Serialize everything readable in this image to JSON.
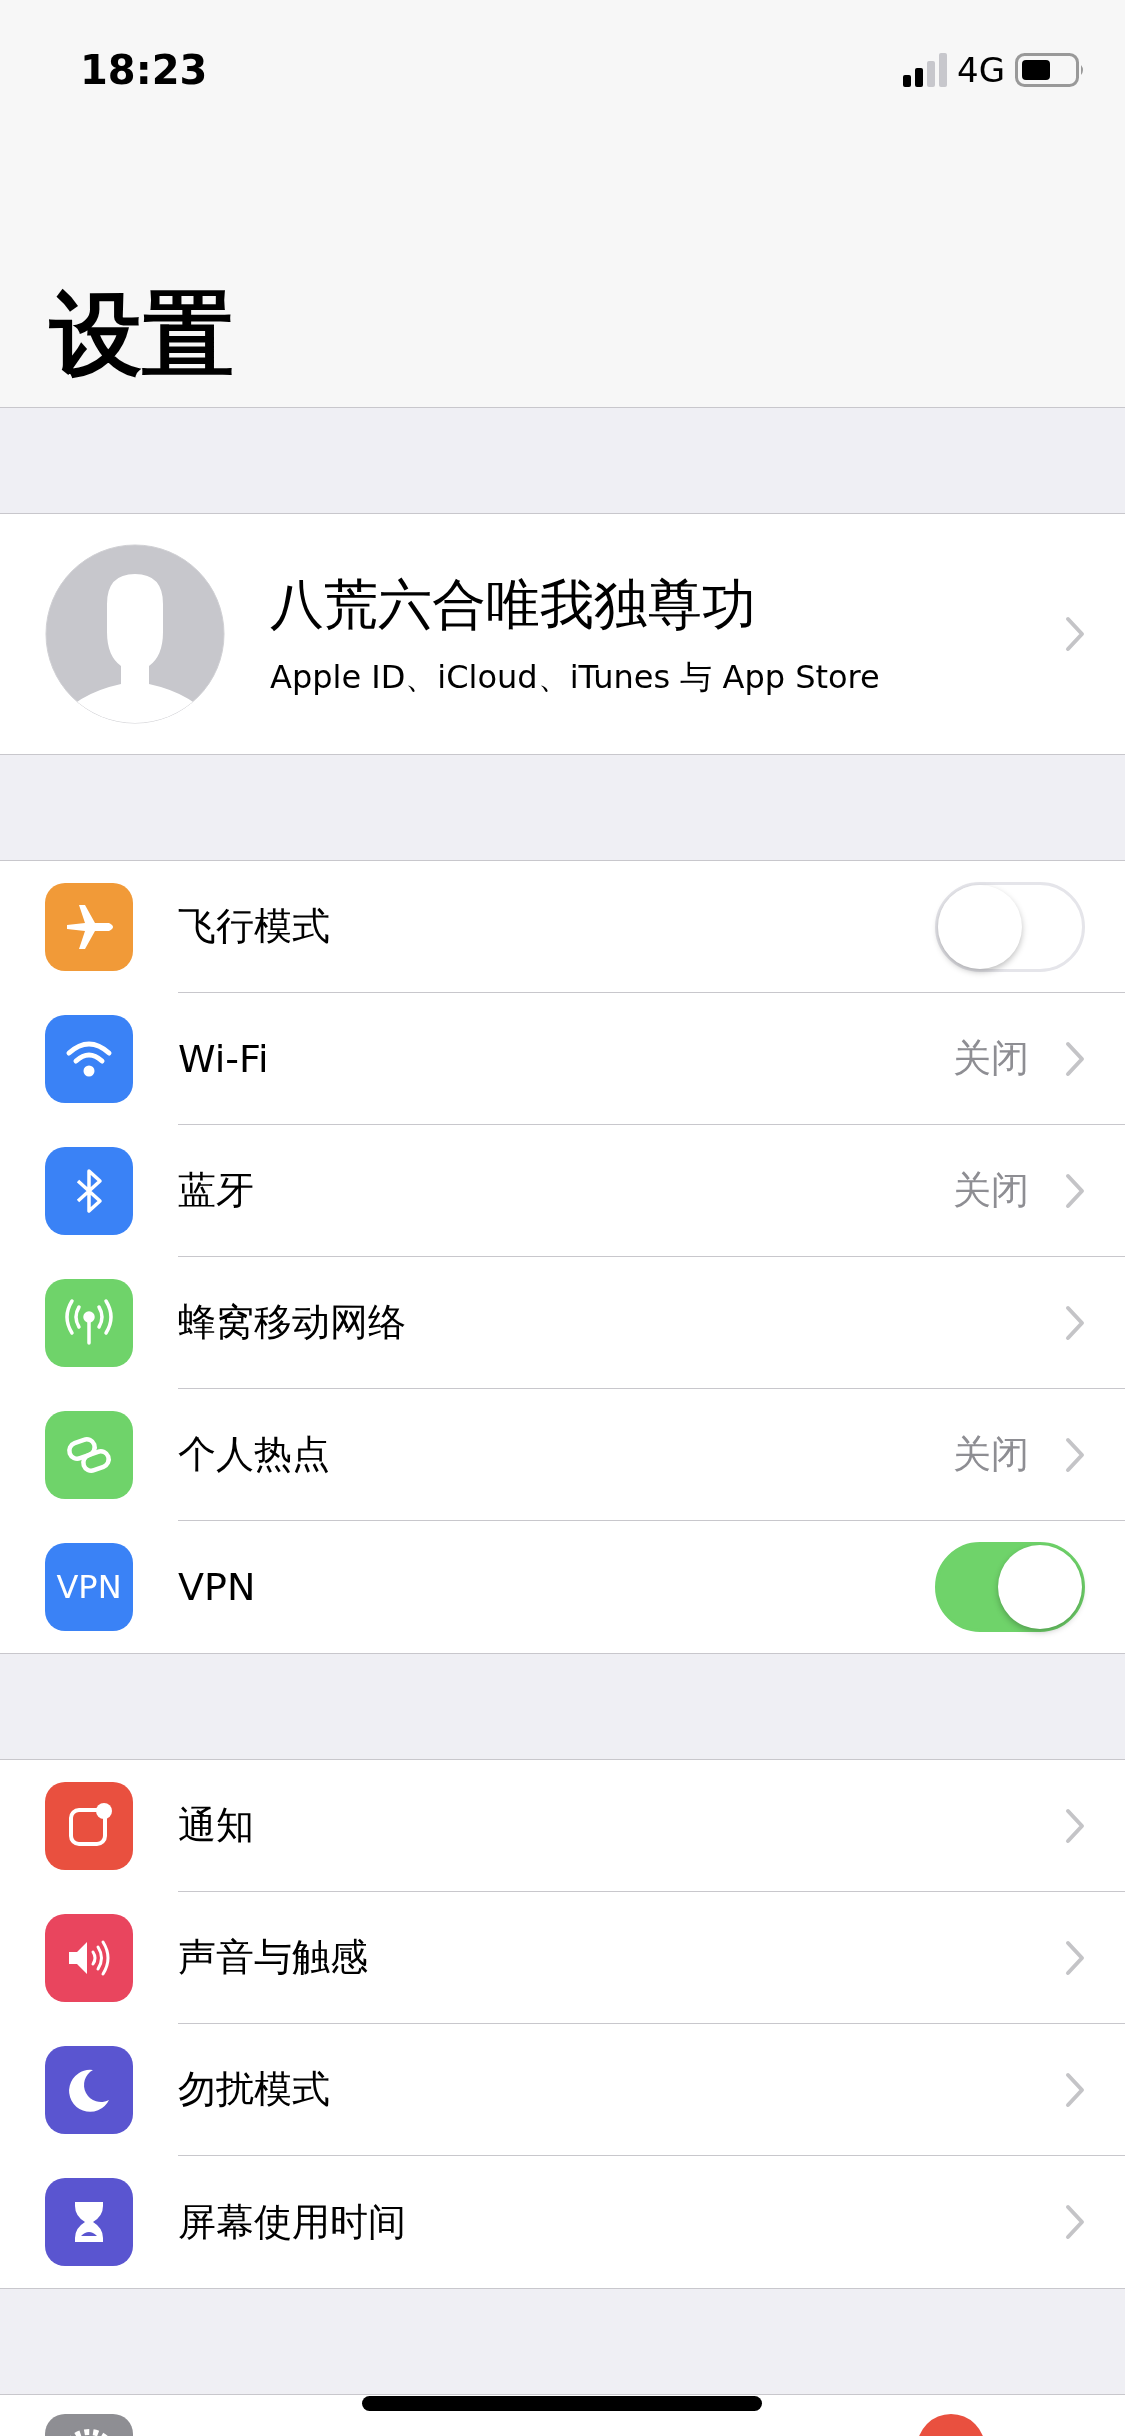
{
  "status_bar": {
    "time": "18:23",
    "network": "4G"
  },
  "title": "设置",
  "profile": {
    "name": "八荒六合唯我独尊功",
    "subtitle": "Apple ID、iCloud、iTunes 与 App Store"
  },
  "groups": [
    {
      "items": [
        {
          "kind": "toggle",
          "label": "飞行模式",
          "color": "#f19a38",
          "on": false
        },
        {
          "kind": "link",
          "label": "Wi-Fi",
          "color": "#3a82f6",
          "value": "关闭"
        },
        {
          "kind": "link",
          "label": "蓝牙",
          "color": "#3a82f6",
          "value": "关闭"
        },
        {
          "kind": "link",
          "label": "蜂窝移动网络",
          "color": "#6fd36a"
        },
        {
          "kind": "link",
          "label": "个人热点",
          "color": "#6fd36a",
          "value": "关闭"
        },
        {
          "kind": "toggle",
          "label": "VPN",
          "color": "#3a82f6",
          "icon_text": "VPN",
          "on": true
        }
      ]
    },
    {
      "items": [
        {
          "kind": "link",
          "label": "通知",
          "color": "#e9503f"
        },
        {
          "kind": "link",
          "label": "声音与触感",
          "color": "#e9455e"
        },
        {
          "kind": "link",
          "label": "勿扰模式",
          "color": "#5a55d0"
        },
        {
          "kind": "link",
          "label": "屏幕使用时间",
          "color": "#5a55d0"
        }
      ]
    }
  ]
}
